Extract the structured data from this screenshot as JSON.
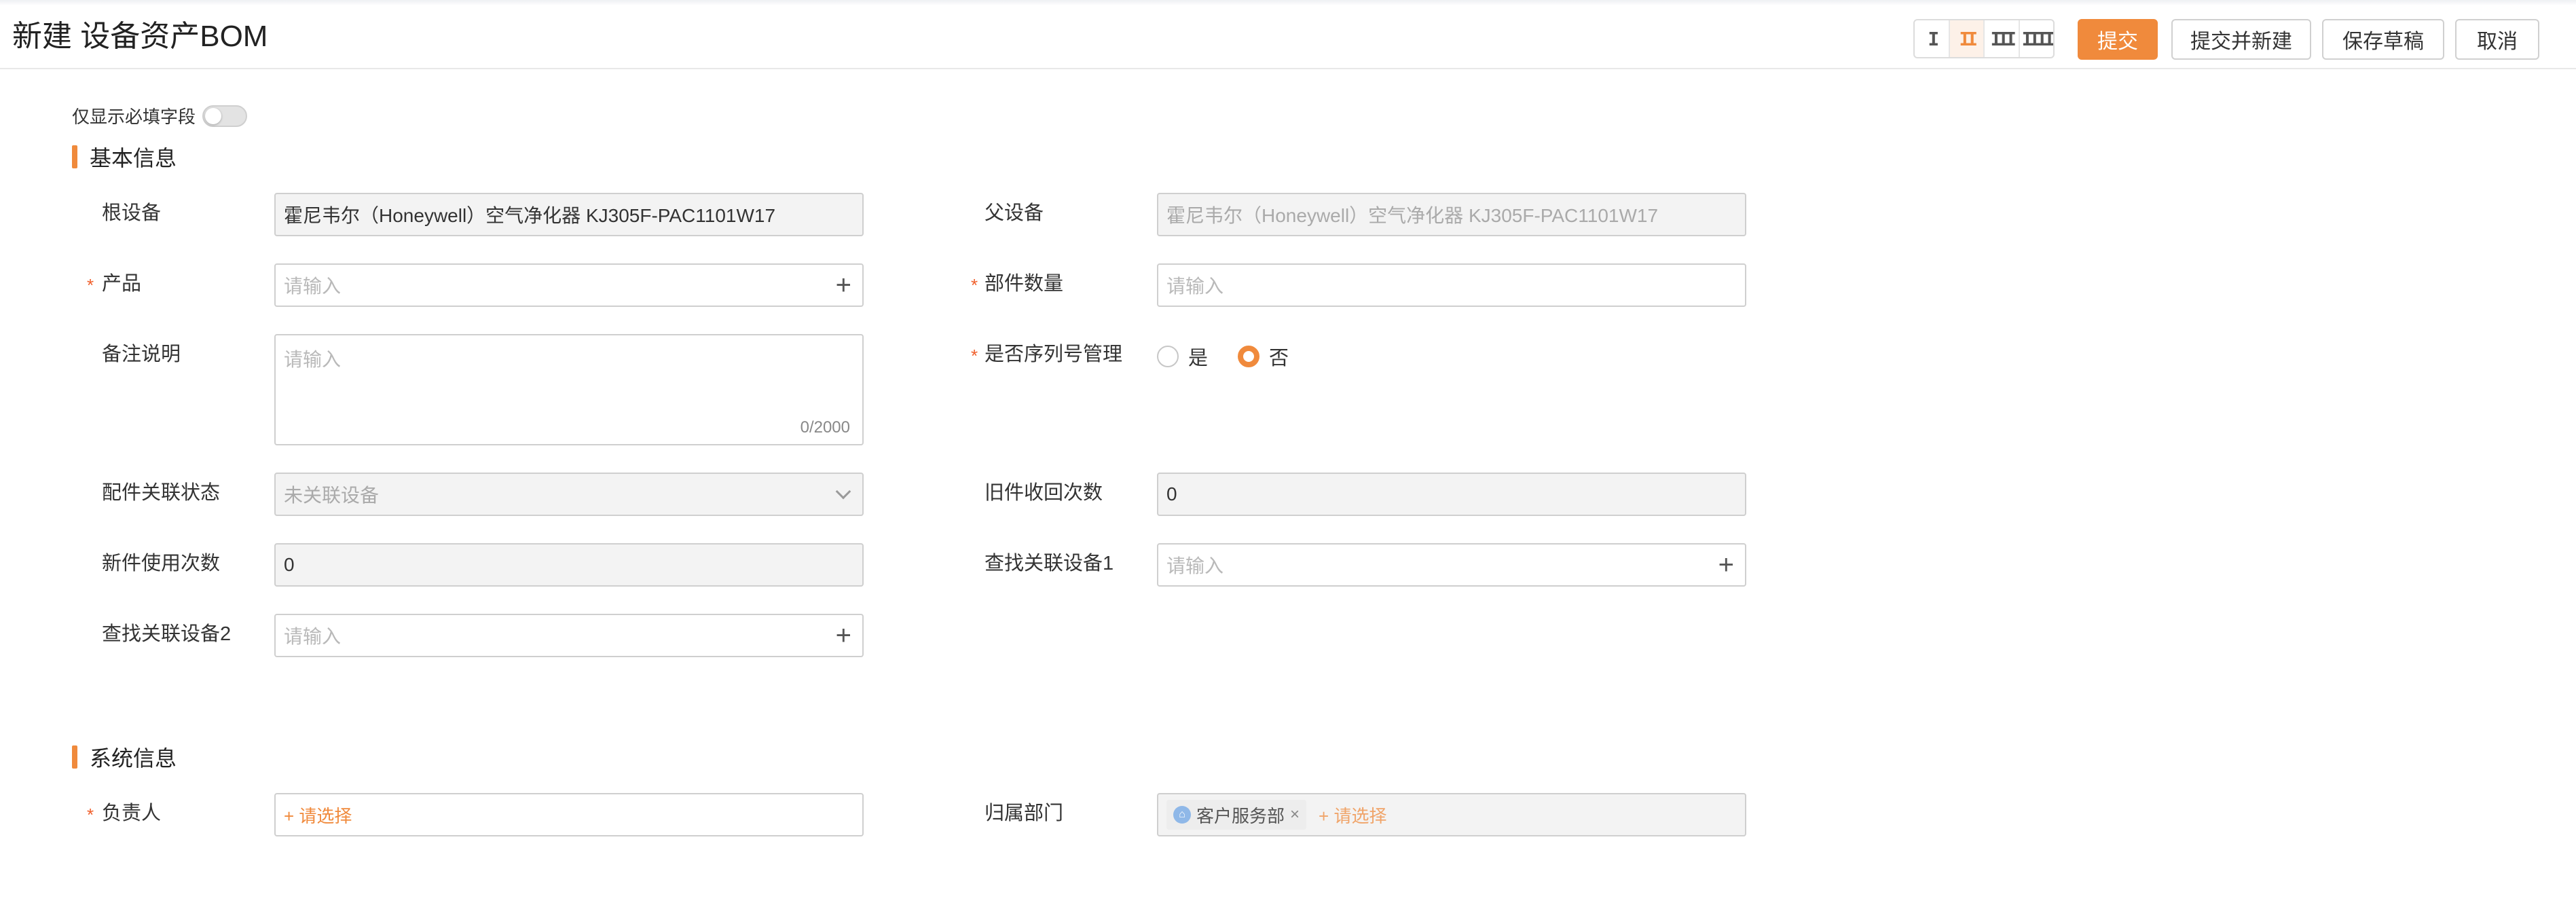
{
  "header": {
    "title": "新建 设备资产BOM",
    "layout_options": [
      "I",
      "II",
      "III",
      "IIII"
    ],
    "layout_active_index": 1,
    "buttons": {
      "submit": "提交",
      "submit_new": "提交并新建",
      "save_draft": "保存草稿",
      "cancel": "取消"
    }
  },
  "toggle": {
    "label": "仅显示必填字段",
    "on": false
  },
  "sections": {
    "basic": "基本信息",
    "system": "系统信息"
  },
  "required_mark": "*",
  "fields": {
    "root_device": {
      "label": "根设备",
      "value": "霍尼韦尔（Honeywell）空气净化器 KJ305F-PAC1101W17"
    },
    "parent_device": {
      "label": "父设备",
      "value": "霍尼韦尔（Honeywell）空气净化器 KJ305F-PAC1101W17"
    },
    "product": {
      "label": "产品",
      "placeholder": "请输入"
    },
    "part_qty": {
      "label": "部件数量",
      "placeholder": "请输入"
    },
    "remark": {
      "label": "备注说明",
      "placeholder": "请输入",
      "counter": "0/2000"
    },
    "serial_mgmt": {
      "label": "是否序列号管理",
      "options": [
        "是",
        "否"
      ],
      "selected": "否"
    },
    "part_link_status": {
      "label": "配件关联状态",
      "value": "未关联设备"
    },
    "old_recycle_count": {
      "label": "旧件收回次数",
      "value": "0"
    },
    "new_use_count": {
      "label": "新件使用次数",
      "value": "0"
    },
    "find_device1": {
      "label": "查找关联设备1",
      "placeholder": "请输入"
    },
    "find_device2": {
      "label": "查找关联设备2",
      "placeholder": "请输入"
    },
    "owner": {
      "label": "负责人",
      "select_text": "+ 请选择"
    },
    "department": {
      "label": "归属部门",
      "tag": "客户服务部",
      "select_text": "+ 请选择"
    }
  },
  "colors": {
    "accent": "#f08a3c",
    "required": "#f0602d"
  }
}
